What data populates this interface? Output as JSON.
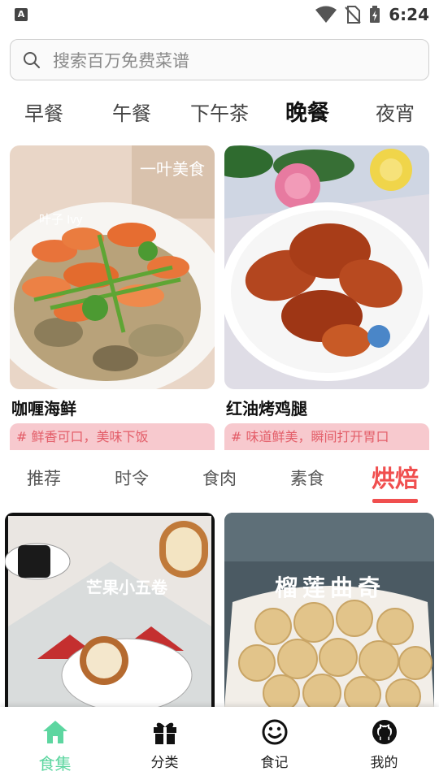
{
  "status_bar": {
    "time": "6:24",
    "left_badge": "A"
  },
  "search": {
    "placeholder": "搜索百万免费菜谱"
  },
  "meal_tabs": [
    {
      "label": "早餐",
      "active": false
    },
    {
      "label": "午餐",
      "active": false
    },
    {
      "label": "下午茶",
      "active": false
    },
    {
      "label": "晚餐",
      "active": true
    },
    {
      "label": "夜宵",
      "active": false
    }
  ],
  "recipes": [
    {
      "title": "咖喱海鲜",
      "tag": "# 鲜香可口，美味下饭",
      "watermark_text": "一叶美食",
      "watermark_logo": "叶子 Ivy"
    },
    {
      "title": "红油烤鸡腿",
      "tag": "# 味道鲜美，瞬间打开胃口"
    }
  ],
  "category_tabs": [
    {
      "label": "推荐",
      "active": false
    },
    {
      "label": "时令",
      "active": false
    },
    {
      "label": "食肉",
      "active": false
    },
    {
      "label": "素食",
      "active": false
    },
    {
      "label": "烘焙",
      "active": true
    }
  ],
  "bottom_cards": [
    {
      "overlay_text": "芒果小五卷"
    },
    {
      "overlay_text": "榴莲曲奇"
    }
  ],
  "nav": [
    {
      "label": "食集",
      "icon": "home-icon",
      "active": true
    },
    {
      "label": "分类",
      "icon": "gift-icon",
      "active": false
    },
    {
      "label": "食记",
      "icon": "smile-icon",
      "active": false
    },
    {
      "label": "我的",
      "icon": "github-icon",
      "active": false
    }
  ],
  "colors": {
    "accent_red": "#f04f4f",
    "accent_green": "#5dd6a0",
    "tag_bg": "#f7c9ce",
    "tag_text": "#e35d68"
  }
}
